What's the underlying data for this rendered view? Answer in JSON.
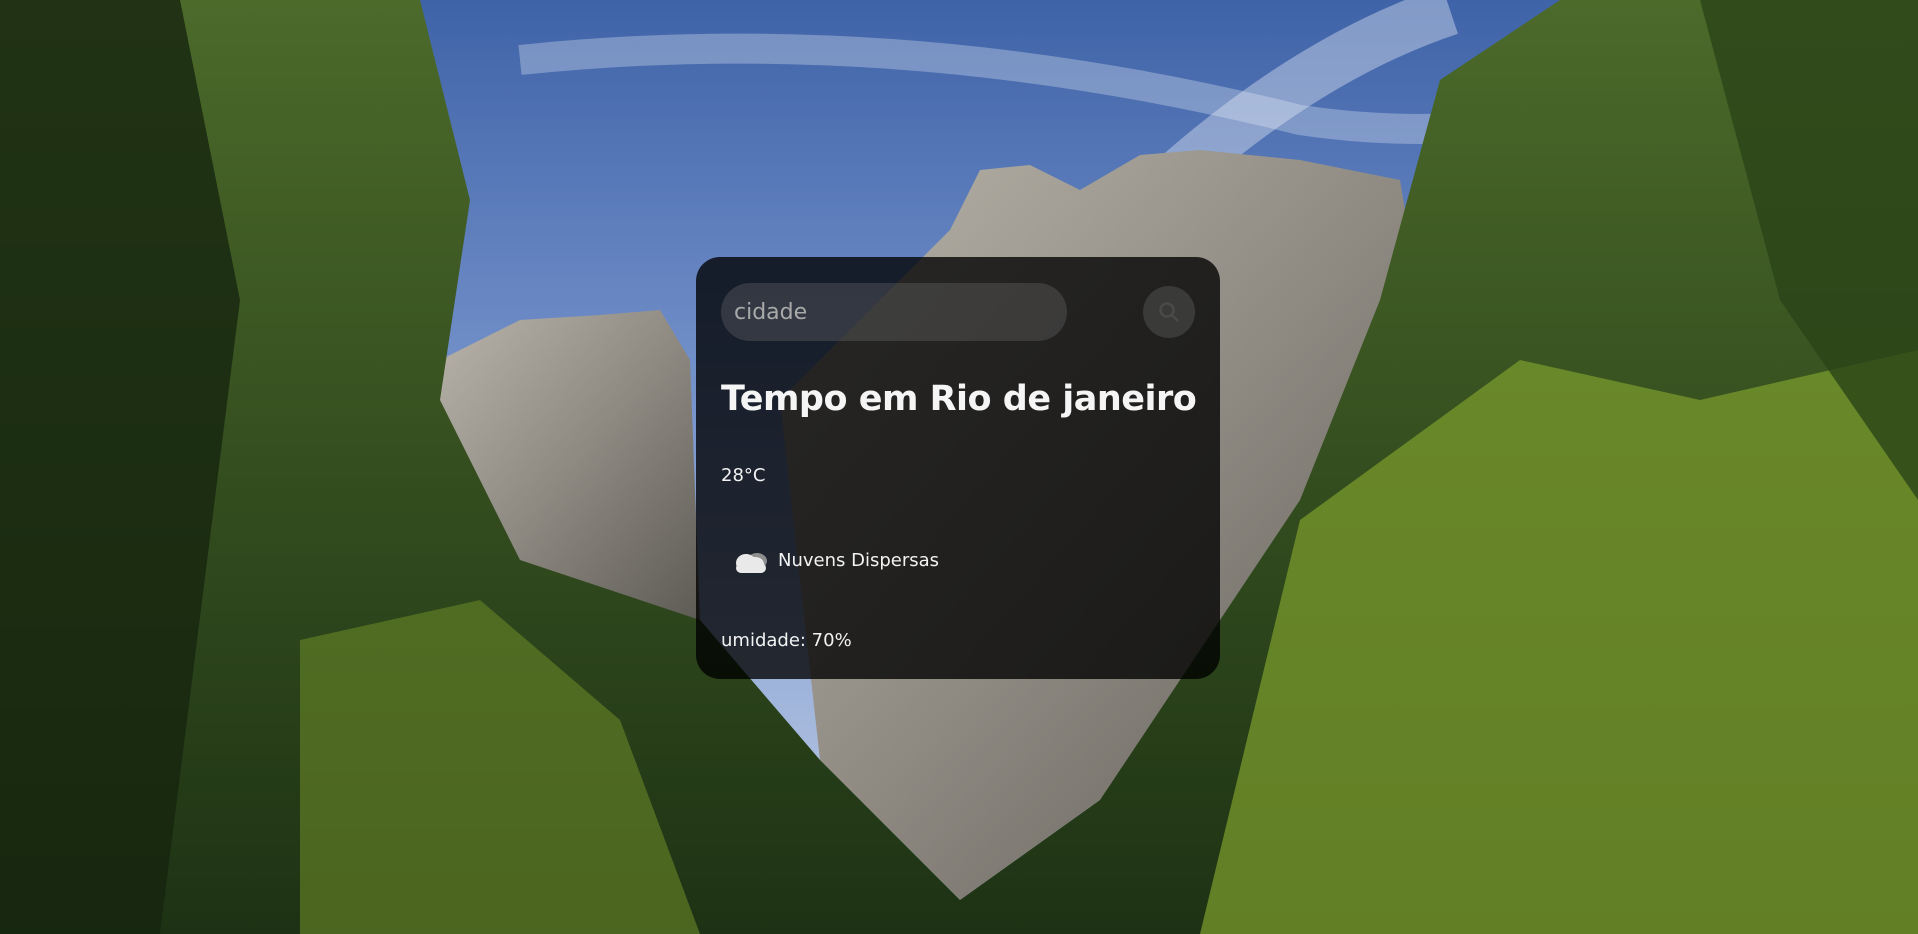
{
  "search": {
    "placeholder": "cidade",
    "value": "",
    "button_icon": "search-icon"
  },
  "weather": {
    "title": "Tempo em Rio de janeiro",
    "temperature": "28°C",
    "condition": "Nuvens Dispersas",
    "condition_icon": "cloud-icon",
    "humidity": "umidade: 70%"
  },
  "colors": {
    "card_background": "#000000",
    "text": "#ffffff",
    "input_background": "#7d7d7d"
  }
}
